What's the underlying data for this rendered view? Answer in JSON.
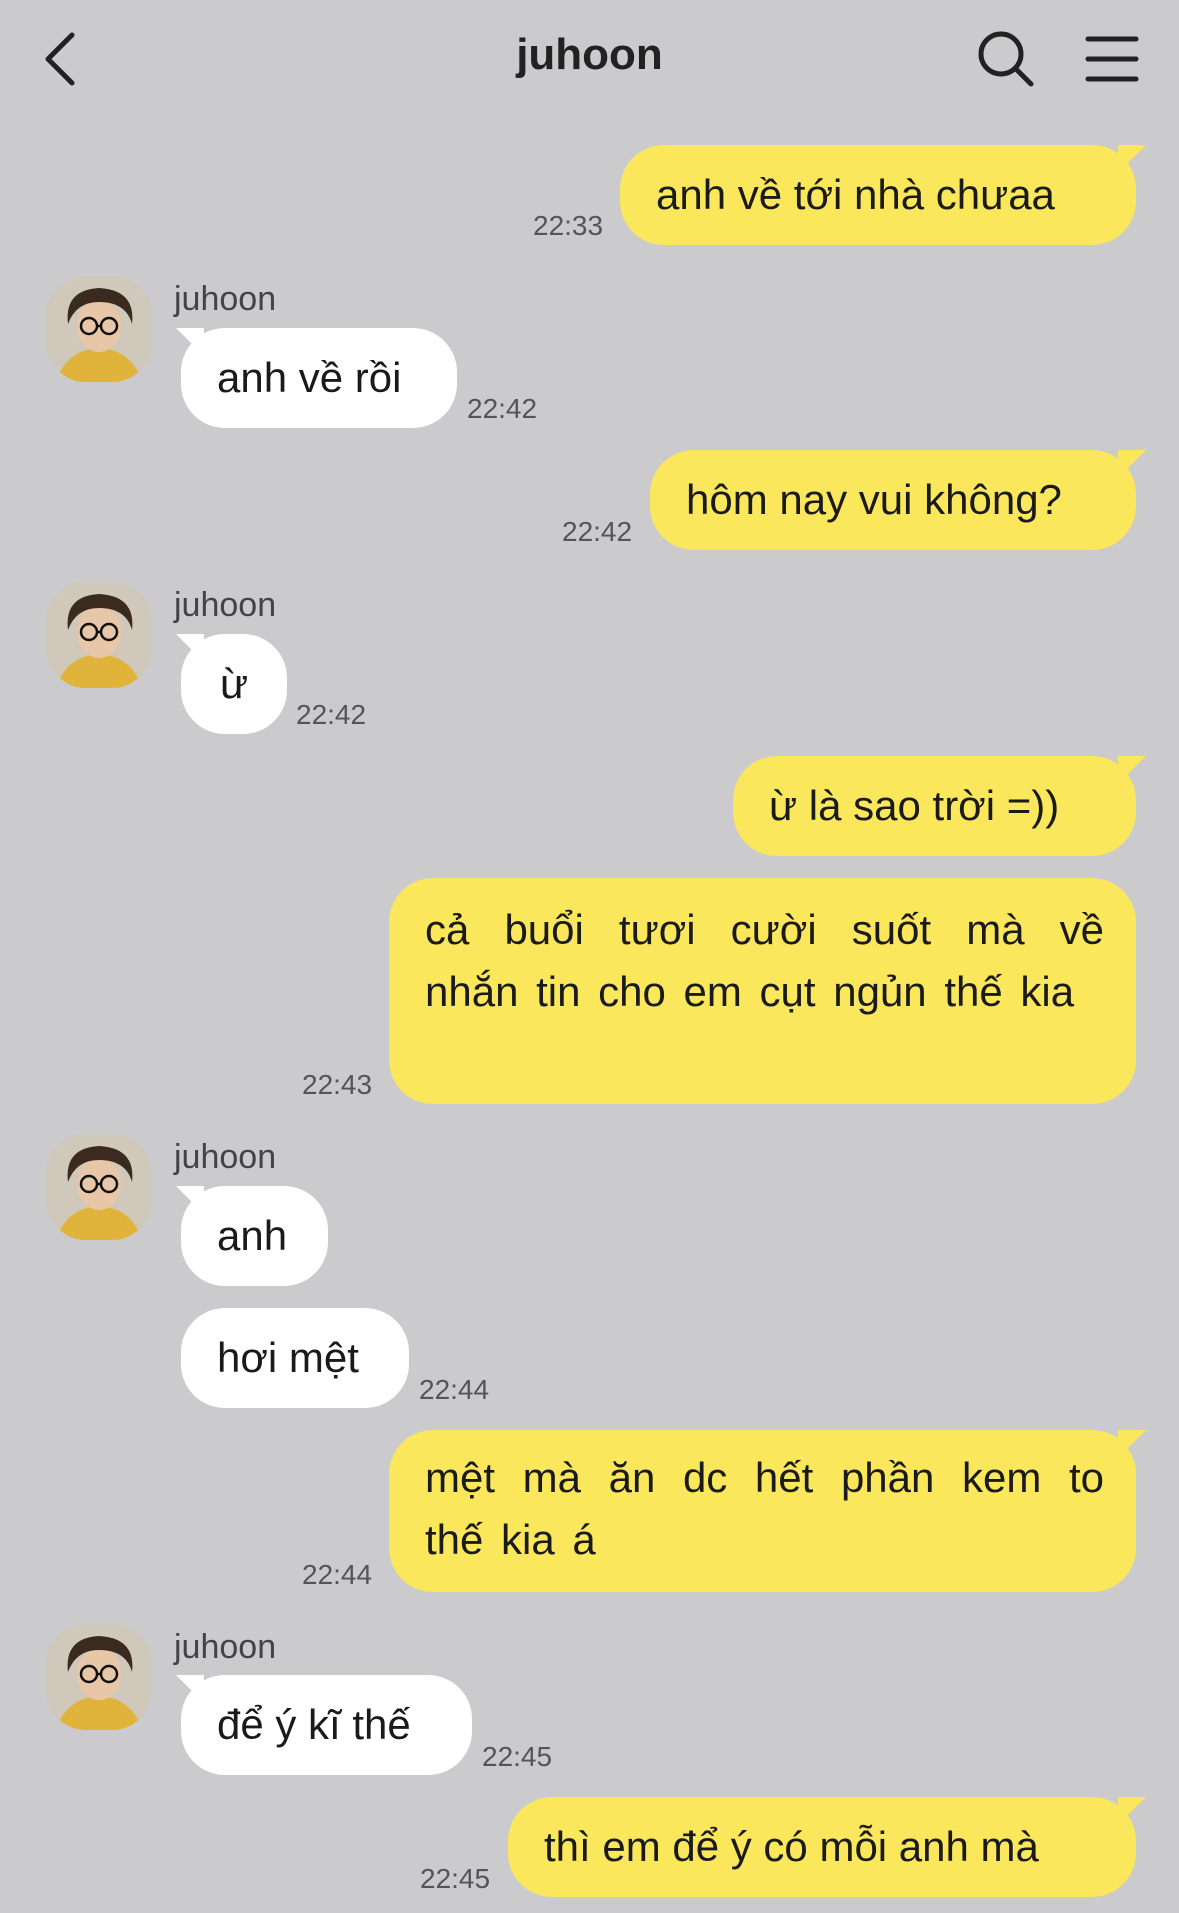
{
  "header": {
    "title": "juhoon",
    "back_icon": "chevron-left-icon",
    "search_icon": "search-icon",
    "menu_icon": "menu-icon"
  },
  "colors": {
    "background": "#cbcbcd",
    "outgoing_bubble": "#fbe75c",
    "incoming_bubble": "#ffffff"
  },
  "messages": [
    {
      "dir": "out",
      "text": "anh về tới nhà chưaa",
      "time": "22:33"
    },
    {
      "dir": "in",
      "sender": "juhoon",
      "text": "anh về rồi",
      "time": "22:42"
    },
    {
      "dir": "out",
      "text": "hôm nay vui không?",
      "time": "22:42"
    },
    {
      "dir": "in",
      "sender": "juhoon",
      "text": "ừ",
      "time": "22:42"
    },
    {
      "dir": "out",
      "text": "ừ là sao trời =))"
    },
    {
      "dir": "out",
      "text": "cả buổi tươi cười suốt mà về nhắn tin cho em cụt ngủn thế kia",
      "time": "22:43"
    },
    {
      "dir": "in",
      "sender": "juhoon",
      "text": "anh"
    },
    {
      "dir": "in",
      "text": "hơi mệt",
      "time": "22:44"
    },
    {
      "dir": "out",
      "text": "mệt mà ăn dc hết phần kem to thế kia á",
      "time": "22:44"
    },
    {
      "dir": "in",
      "sender": "juhoon",
      "text": "để ý kĩ thế",
      "time": "22:45"
    },
    {
      "dir": "out",
      "text": "thì em để ý có mỗi anh mà",
      "time": "22:45"
    }
  ]
}
